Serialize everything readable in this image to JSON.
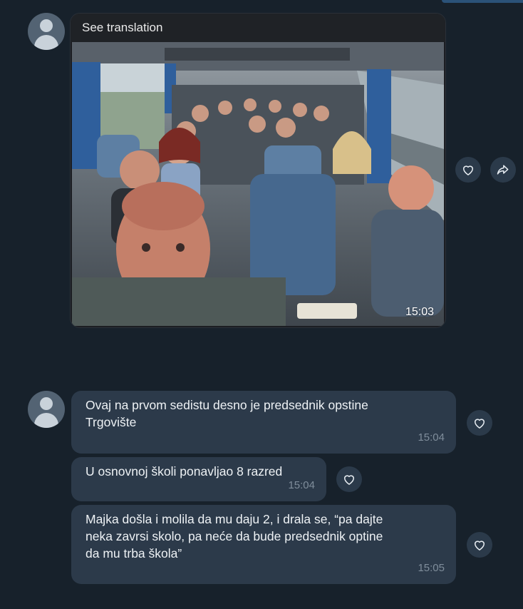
{
  "media_message": {
    "translation_label": "See translation",
    "time": "15:03"
  },
  "messages": [
    {
      "text": "Ovaj na prvom sedistu desno je predsednik opstine\nTrgovište",
      "time": "15:04"
    },
    {
      "text": "U osnovnoj školi ponavljao 8 razred",
      "time": "15:04"
    },
    {
      "text": "Majka došla i molila da mu daju 2, i drala se, “pa dajte\nneka zavrsi skolo, pa neće da bude predsednik optine\nda mu trba škola”",
      "time": "15:05"
    }
  ],
  "icons": {
    "like": "heart-icon",
    "share": "share-arrow-icon",
    "avatar": "user-avatar-icon"
  },
  "colors": {
    "background": "#17212b",
    "bubble": "#2c3a4a",
    "action_button": "#2b3a4a"
  }
}
